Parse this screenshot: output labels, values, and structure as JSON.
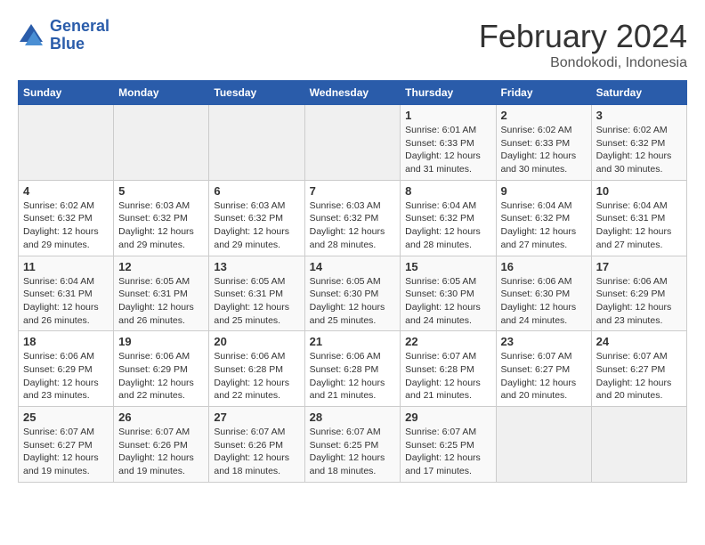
{
  "header": {
    "logo_line1": "General",
    "logo_line2": "Blue",
    "title": "February 2024",
    "subtitle": "Bondokodi, Indonesia"
  },
  "weekdays": [
    "Sunday",
    "Monday",
    "Tuesday",
    "Wednesday",
    "Thursday",
    "Friday",
    "Saturday"
  ],
  "weeks": [
    [
      {
        "day": "",
        "info": ""
      },
      {
        "day": "",
        "info": ""
      },
      {
        "day": "",
        "info": ""
      },
      {
        "day": "",
        "info": ""
      },
      {
        "day": "1",
        "info": "Sunrise: 6:01 AM\nSunset: 6:33 PM\nDaylight: 12 hours and 31 minutes."
      },
      {
        "day": "2",
        "info": "Sunrise: 6:02 AM\nSunset: 6:33 PM\nDaylight: 12 hours and 30 minutes."
      },
      {
        "day": "3",
        "info": "Sunrise: 6:02 AM\nSunset: 6:32 PM\nDaylight: 12 hours and 30 minutes."
      }
    ],
    [
      {
        "day": "4",
        "info": "Sunrise: 6:02 AM\nSunset: 6:32 PM\nDaylight: 12 hours and 29 minutes."
      },
      {
        "day": "5",
        "info": "Sunrise: 6:03 AM\nSunset: 6:32 PM\nDaylight: 12 hours and 29 minutes."
      },
      {
        "day": "6",
        "info": "Sunrise: 6:03 AM\nSunset: 6:32 PM\nDaylight: 12 hours and 29 minutes."
      },
      {
        "day": "7",
        "info": "Sunrise: 6:03 AM\nSunset: 6:32 PM\nDaylight: 12 hours and 28 minutes."
      },
      {
        "day": "8",
        "info": "Sunrise: 6:04 AM\nSunset: 6:32 PM\nDaylight: 12 hours and 28 minutes."
      },
      {
        "day": "9",
        "info": "Sunrise: 6:04 AM\nSunset: 6:32 PM\nDaylight: 12 hours and 27 minutes."
      },
      {
        "day": "10",
        "info": "Sunrise: 6:04 AM\nSunset: 6:31 PM\nDaylight: 12 hours and 27 minutes."
      }
    ],
    [
      {
        "day": "11",
        "info": "Sunrise: 6:04 AM\nSunset: 6:31 PM\nDaylight: 12 hours and 26 minutes."
      },
      {
        "day": "12",
        "info": "Sunrise: 6:05 AM\nSunset: 6:31 PM\nDaylight: 12 hours and 26 minutes."
      },
      {
        "day": "13",
        "info": "Sunrise: 6:05 AM\nSunset: 6:31 PM\nDaylight: 12 hours and 25 minutes."
      },
      {
        "day": "14",
        "info": "Sunrise: 6:05 AM\nSunset: 6:30 PM\nDaylight: 12 hours and 25 minutes."
      },
      {
        "day": "15",
        "info": "Sunrise: 6:05 AM\nSunset: 6:30 PM\nDaylight: 12 hours and 24 minutes."
      },
      {
        "day": "16",
        "info": "Sunrise: 6:06 AM\nSunset: 6:30 PM\nDaylight: 12 hours and 24 minutes."
      },
      {
        "day": "17",
        "info": "Sunrise: 6:06 AM\nSunset: 6:29 PM\nDaylight: 12 hours and 23 minutes."
      }
    ],
    [
      {
        "day": "18",
        "info": "Sunrise: 6:06 AM\nSunset: 6:29 PM\nDaylight: 12 hours and 23 minutes."
      },
      {
        "day": "19",
        "info": "Sunrise: 6:06 AM\nSunset: 6:29 PM\nDaylight: 12 hours and 22 minutes."
      },
      {
        "day": "20",
        "info": "Sunrise: 6:06 AM\nSunset: 6:28 PM\nDaylight: 12 hours and 22 minutes."
      },
      {
        "day": "21",
        "info": "Sunrise: 6:06 AM\nSunset: 6:28 PM\nDaylight: 12 hours and 21 minutes."
      },
      {
        "day": "22",
        "info": "Sunrise: 6:07 AM\nSunset: 6:28 PM\nDaylight: 12 hours and 21 minutes."
      },
      {
        "day": "23",
        "info": "Sunrise: 6:07 AM\nSunset: 6:27 PM\nDaylight: 12 hours and 20 minutes."
      },
      {
        "day": "24",
        "info": "Sunrise: 6:07 AM\nSunset: 6:27 PM\nDaylight: 12 hours and 20 minutes."
      }
    ],
    [
      {
        "day": "25",
        "info": "Sunrise: 6:07 AM\nSunset: 6:27 PM\nDaylight: 12 hours and 19 minutes."
      },
      {
        "day": "26",
        "info": "Sunrise: 6:07 AM\nSunset: 6:26 PM\nDaylight: 12 hours and 19 minutes."
      },
      {
        "day": "27",
        "info": "Sunrise: 6:07 AM\nSunset: 6:26 PM\nDaylight: 12 hours and 18 minutes."
      },
      {
        "day": "28",
        "info": "Sunrise: 6:07 AM\nSunset: 6:25 PM\nDaylight: 12 hours and 18 minutes."
      },
      {
        "day": "29",
        "info": "Sunrise: 6:07 AM\nSunset: 6:25 PM\nDaylight: 12 hours and 17 minutes."
      },
      {
        "day": "",
        "info": ""
      },
      {
        "day": "",
        "info": ""
      }
    ]
  ]
}
